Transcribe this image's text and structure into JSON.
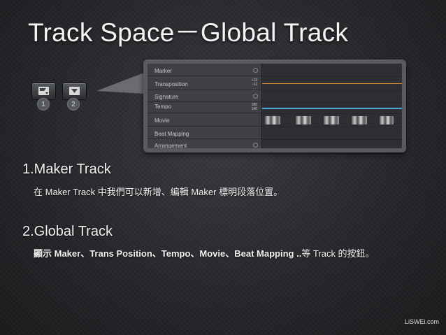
{
  "title": "Track Space－Global Track",
  "toolbar": {
    "button1_num": "1",
    "button2_num": "2"
  },
  "global_tracks": {
    "rows": [
      {
        "label": "Marker"
      },
      {
        "label": "Transposition",
        "value_top": "+12",
        "value_bottom": "-12"
      },
      {
        "label": "Signature"
      },
      {
        "label": "Tempo",
        "value_top": "180",
        "value_bottom": "140"
      },
      {
        "label": "Movie"
      },
      {
        "label": "Beat Mapping"
      },
      {
        "label": "Arrangement"
      }
    ]
  },
  "section1": {
    "heading": "1.Maker Track",
    "body": "在 Maker Track 中我們可以新增、編輯 Maker 標明段落位置。"
  },
  "section2": {
    "heading": "2.Global Track",
    "body_bold": "顯示 Maker、Trans Position、Tempo、Movie、Beat Mapping ..",
    "body_rest": "等 Track 的按鈕。"
  },
  "footer": "LiSWEi.com",
  "colors": {
    "transposition_line": "#d8892e",
    "tempo_line": "#4aa9d8"
  }
}
